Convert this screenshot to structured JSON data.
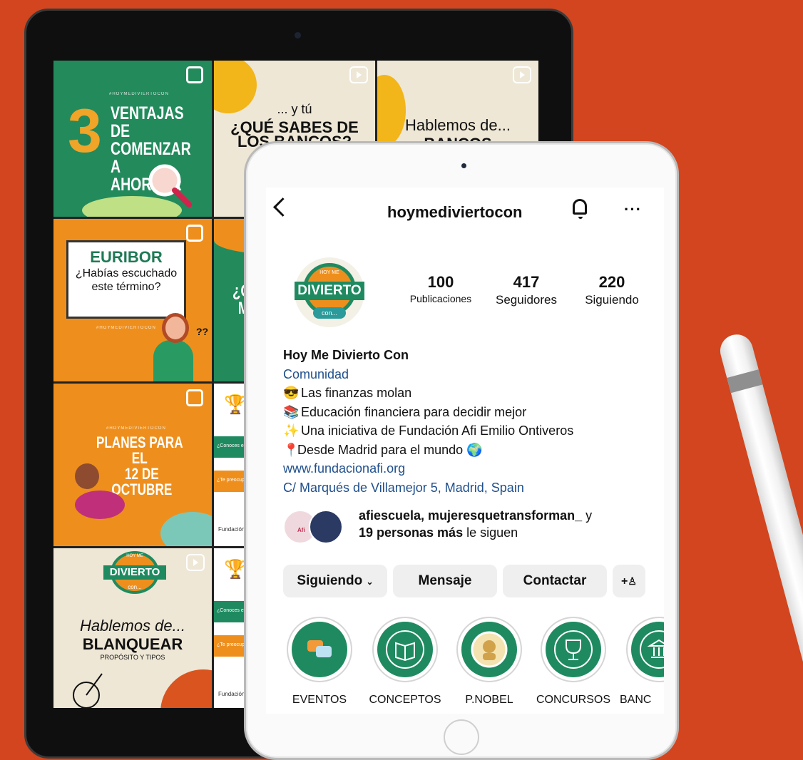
{
  "grid_tiles": {
    "t1": {
      "tag": "#HOYMEDIVIERTOCON",
      "number": "3",
      "line1": "VENTAJAS DE",
      "line2": "COMENZAR A",
      "line3": "AHORRAR"
    },
    "t2": {
      "pre": "... y tú",
      "line1": "¿QUÉ SABES DE",
      "line2": "LOS BANCOS?"
    },
    "t3": {
      "line1": "Hablemos de...",
      "line2": "BANCOS"
    },
    "t4": {
      "title": "EURIBOR",
      "line1": "¿Habías escuchado",
      "line2": "este término?",
      "tag": "#HOYMEDIVIERTOCON",
      "marks": "??"
    },
    "t5": {
      "line1": "¿CÓ",
      "line2": "M"
    },
    "t7": {
      "tag": "#HOYMEDIVIERTOCON",
      "line1": "PLANES PARA EL",
      "line2": "12 DE OCTUBRE"
    },
    "t8": {
      "l1": "¿Conoces el términ",
      "l2": "¿Te preocupa el me",
      "l3": "Fundación"
    },
    "t10": {
      "logo_top": "HOY ME",
      "logo_mid": "DIVIERTO",
      "logo_bot": "con...",
      "line1": "Hablemos de...",
      "line2": "BLANQUEAR",
      "line3": "PROPÓSITO Y TIPOS"
    },
    "t11": {
      "l1": "¿Conoces el términ",
      "l2": "¿Te preocupa el me",
      "l3": "Fundación"
    }
  },
  "profile": {
    "username": "hoymediviertocon",
    "avatar": {
      "top": "HOY ME",
      "mid": "DIVIERTO",
      "bot": "con..."
    },
    "stats": [
      {
        "value": "100",
        "label": "Publicaciones"
      },
      {
        "value": "417",
        "label": "Seguidores"
      },
      {
        "value": "220",
        "label": "Siguiendo"
      }
    ],
    "name": "Hoy Me Divierto Con",
    "category": "Comunidad",
    "bio": [
      {
        "emoji": "😎",
        "text": "Las finanzas molan"
      },
      {
        "emoji": "📚",
        "text": "Educación financiera para decidir mejor"
      },
      {
        "emoji": "✨",
        "text": "Una iniciativa de Fundación Afi Emilio Ontiveros"
      },
      {
        "emoji": "📍",
        "text": "Desde Madrid para el mundo 🌍"
      }
    ],
    "website": "www.fundacionafi.org",
    "address": "C/ Marqués de Villamejor 5, Madrid, Spain",
    "followed_by": {
      "names": "afiescuela, mujeresquetransforman_",
      "y": "y",
      "count": "19 personas más",
      "suffix": "le siguen",
      "avatar_label": "Afi"
    },
    "buttons": {
      "following": "Siguiendo",
      "message": "Mensaje",
      "contact": "Contactar",
      "add_user": "+"
    },
    "highlights": [
      {
        "label": "EVENTOS"
      },
      {
        "label": "CONCEPTOS"
      },
      {
        "label": "P.NOBEL"
      },
      {
        "label": "CONCURSOS"
      },
      {
        "label": "BANC"
      }
    ]
  },
  "colors": {
    "background": "#d2451e",
    "brand_green": "#1f8a60",
    "brand_orange": "#ee8f1d",
    "cream": "#eee7d6",
    "link_blue": "#1f4f8c"
  }
}
